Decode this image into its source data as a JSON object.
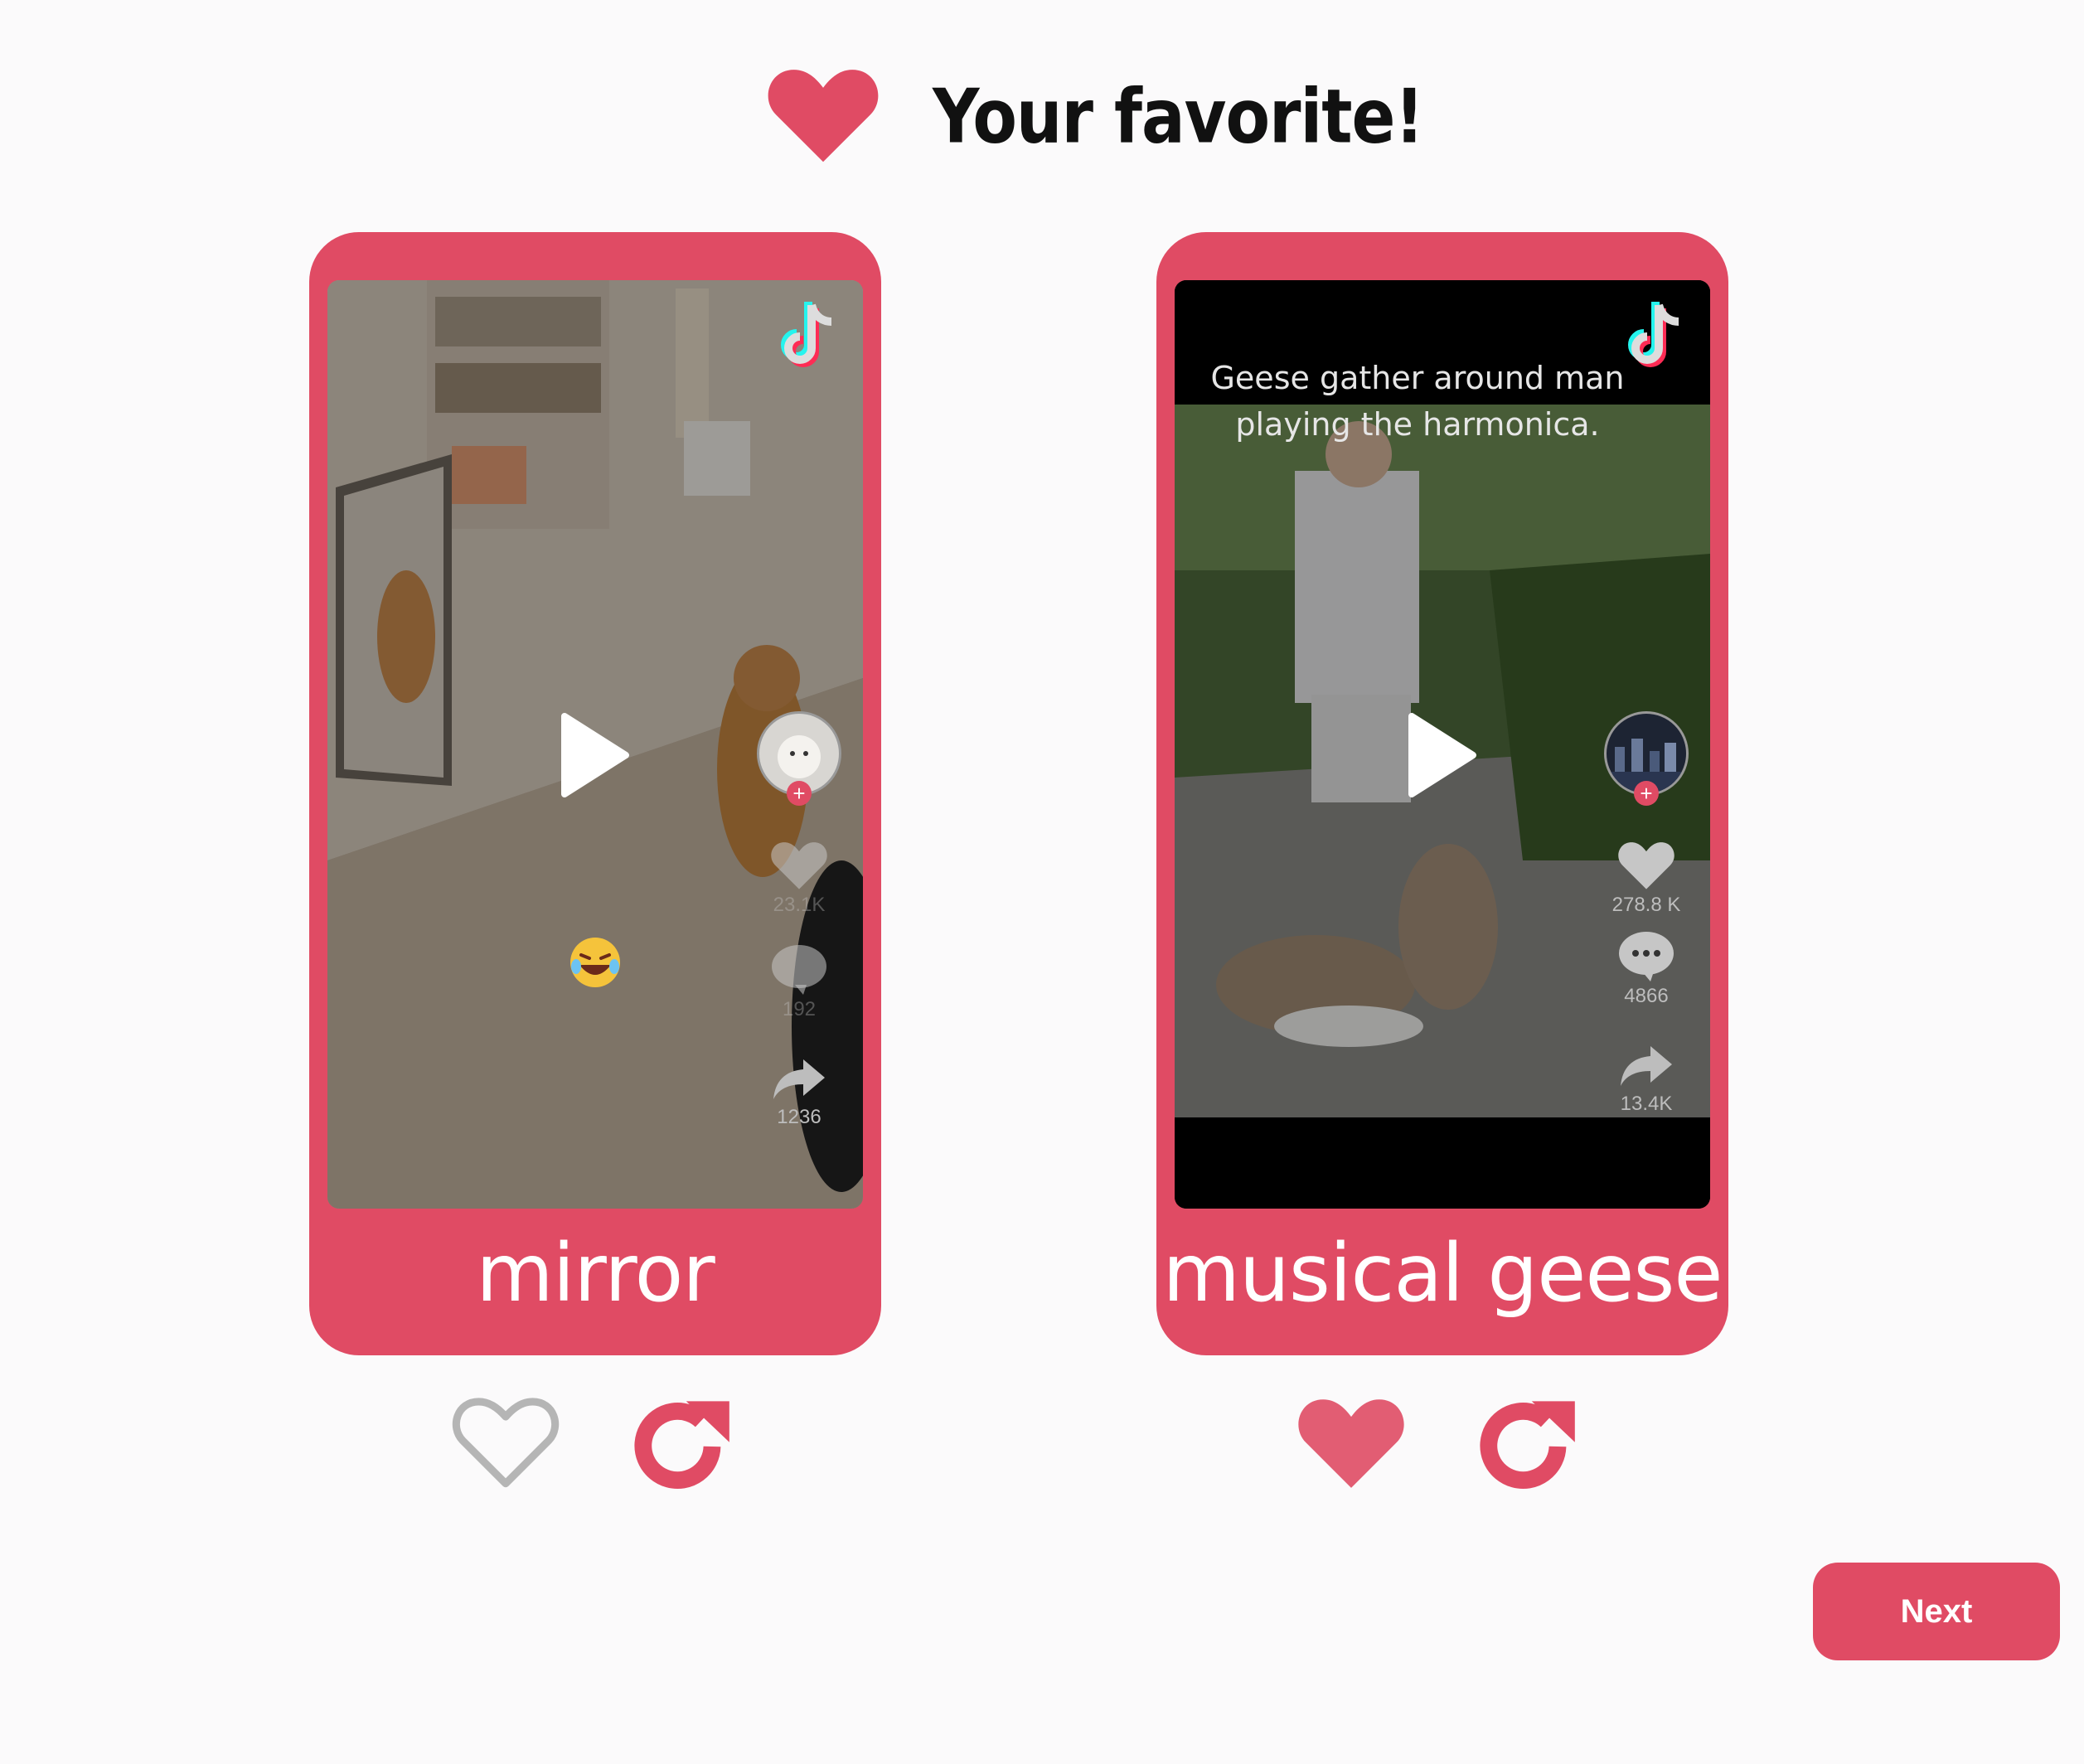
{
  "header": {
    "title": "Your favorite!",
    "icon": "heart-icon"
  },
  "colors": {
    "accent": "#e04b64",
    "background": "#fbfafb",
    "inactive": "#bdbdbd"
  },
  "videos": [
    {
      "label": "mirror",
      "caption": "",
      "stats": {
        "likes": "23.1K",
        "comments": "192",
        "shares": "1236"
      },
      "favorited": false
    },
    {
      "label": "musical geese",
      "caption": "Geese gather around man playing the harmonica.",
      "stats": {
        "likes": "278.8 K",
        "comments": "4866",
        "shares": "13.4K"
      },
      "favorited": true
    }
  ],
  "next_button": {
    "label": "Next"
  }
}
